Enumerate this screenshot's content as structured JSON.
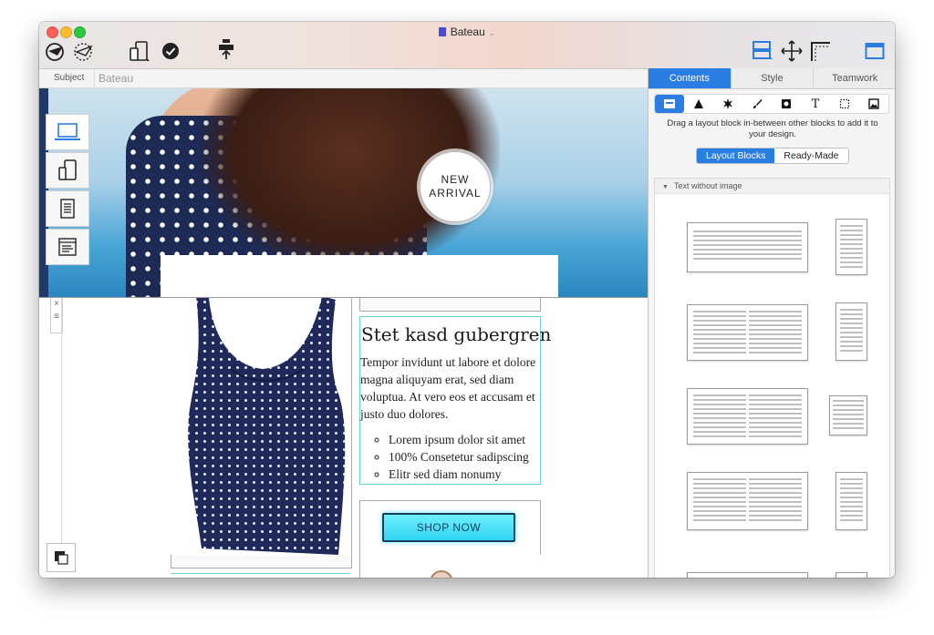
{
  "window": {
    "title": "Bateau"
  },
  "subject": {
    "label": "Subject",
    "value": "Bateau"
  },
  "hero": {
    "badge_line1": "NEW",
    "badge_line2": "ARRIVAL"
  },
  "product": {
    "title": "Stet kasd gubergren",
    "paragraph": "Tempor invidunt ut labore et dolore magna aliquyam erat, sed diam voluptua. At vero eos et accusam et justo duo dolores.",
    "bullets": [
      "Lorem ipsum dolor sit amet",
      "100% Consetetur sadipscing",
      "Elitr sed diam nonumy"
    ],
    "button_label": "SHOP NOW"
  },
  "panel": {
    "tabs": [
      "Contents",
      "Style",
      "Teamwork"
    ],
    "active_tab": "Contents",
    "hint": "Drag a layout block in-between other blocks to add it to your design.",
    "segments": [
      "Layout Blocks",
      "Ready-Made"
    ],
    "section_header": "Text without image",
    "tool_text_glyph": "T"
  },
  "colors": {
    "accent": "#2a7de1",
    "shop_button": "#3fdcf5",
    "frame_teal": "#6cd0d8"
  },
  "icons": {
    "toolbar": [
      "send-plane-icon",
      "schedule-plane-icon",
      "device-preview-icon",
      "check-icon",
      "upload-icon",
      "layout-icon",
      "move-icon",
      "margin-icon",
      "panel-toggle-icon"
    ],
    "panel_tools": [
      "block-icon",
      "triangle-icon",
      "burst-icon",
      "brush-icon",
      "image-frame-icon",
      "text-icon",
      "selection-icon",
      "picture-icon"
    ]
  }
}
